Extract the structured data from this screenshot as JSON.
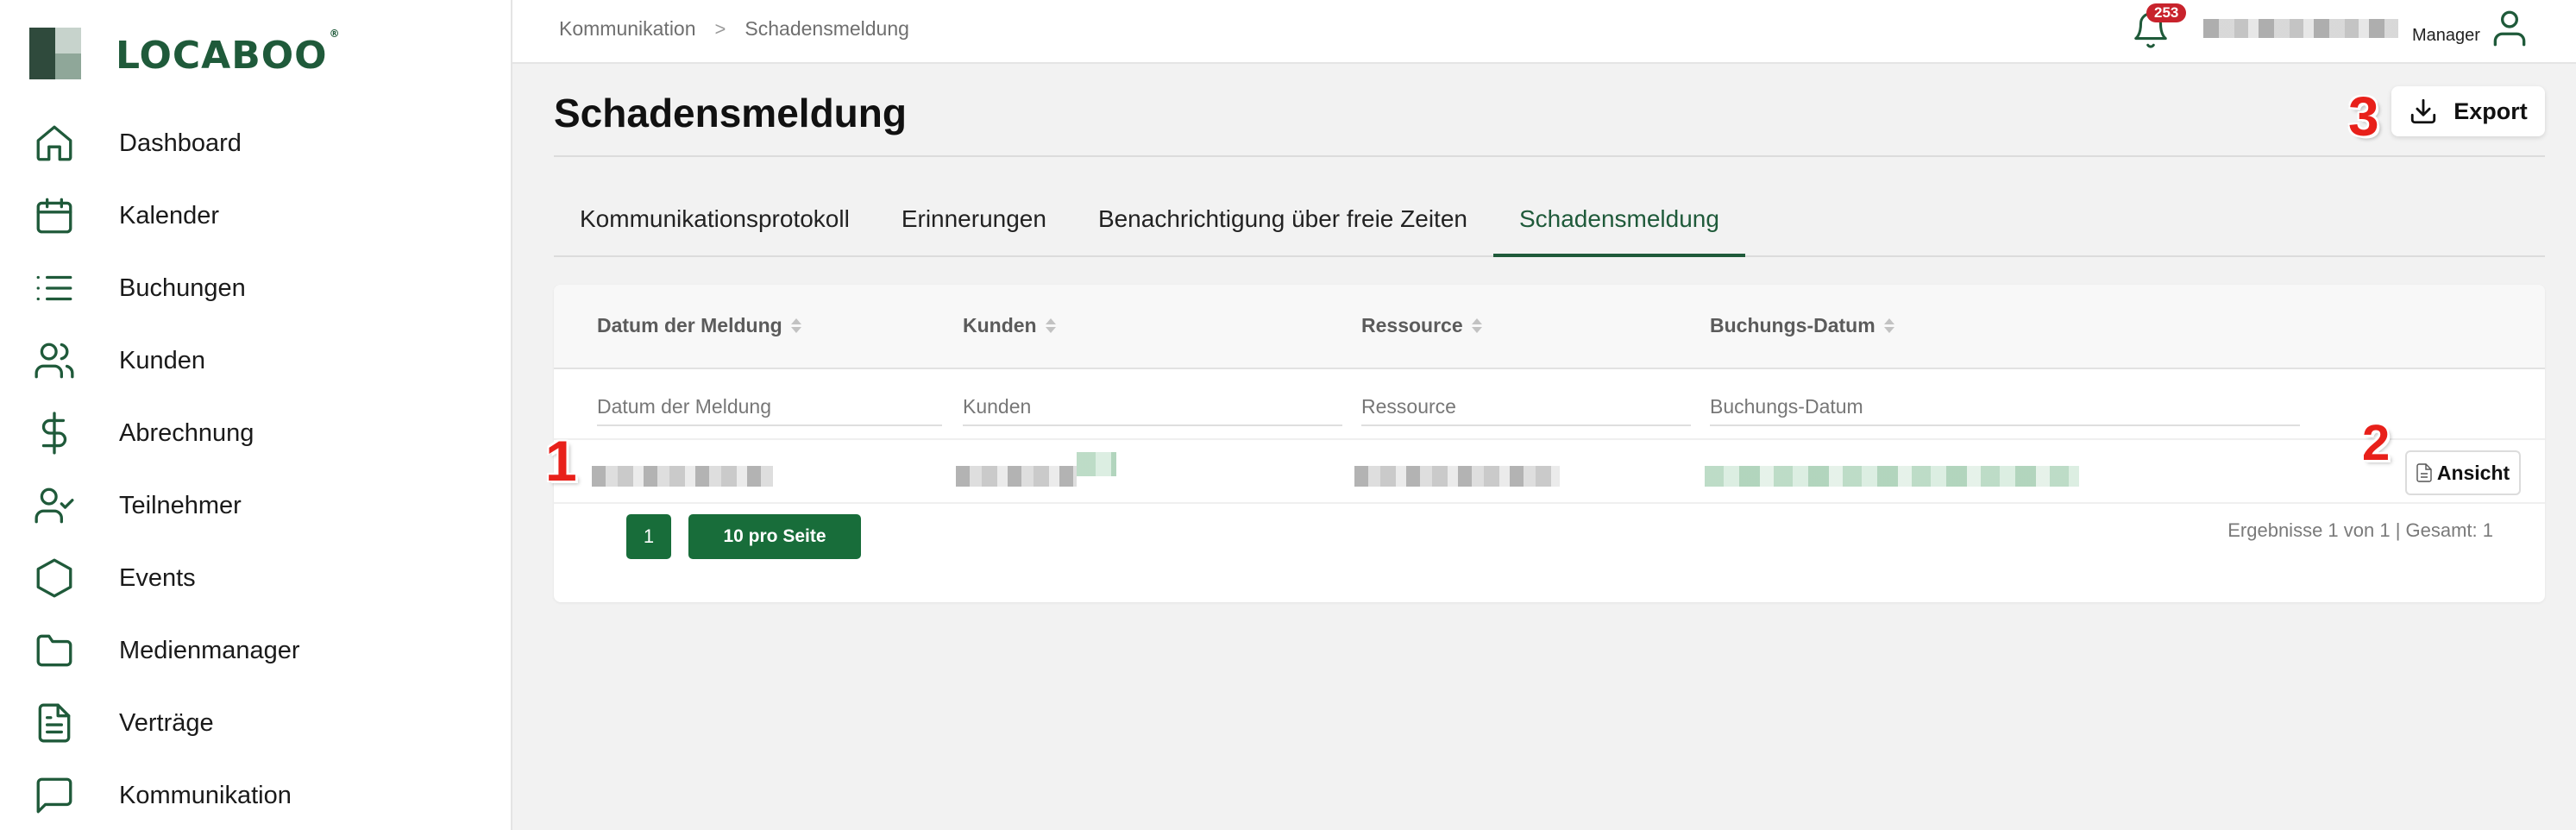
{
  "app": {
    "logo_text": "LOCABOO",
    "logo_mark": "®"
  },
  "colors": {
    "brand_green": "#1f5a3a",
    "button_green": "#186d3a",
    "badge_red": "#c8232c",
    "annotation_red": "#e8201a"
  },
  "sidebar": {
    "items": [
      {
        "label": "Dashboard",
        "icon": "home-icon"
      },
      {
        "label": "Kalender",
        "icon": "calendar-icon"
      },
      {
        "label": "Buchungen",
        "icon": "list-icon"
      },
      {
        "label": "Kunden",
        "icon": "users-icon"
      },
      {
        "label": "Abrechnung",
        "icon": "dollar-icon"
      },
      {
        "label": "Teilnehmer",
        "icon": "user-check-icon"
      },
      {
        "label": "Events",
        "icon": "hexagon-icon"
      },
      {
        "label": "Medienmanager",
        "icon": "folder-icon"
      },
      {
        "label": "Verträge",
        "icon": "document-icon"
      },
      {
        "label": "Kommunikation",
        "icon": "chat-icon"
      }
    ]
  },
  "topbar": {
    "breadcrumb": [
      "Kommunikation",
      "Schadensmeldung"
    ],
    "breadcrumb_separator": ">",
    "notification_count": "253",
    "user_role": "Manager"
  },
  "main": {
    "title": "Schadensmeldung",
    "export_label": "Export",
    "tabs": [
      {
        "label": "Kommunikationsprotokoll",
        "active": false
      },
      {
        "label": "Erinnerungen",
        "active": false
      },
      {
        "label": "Benachrichtigung über freie Zeiten",
        "active": false
      },
      {
        "label": "Schadensmeldung",
        "active": true
      }
    ]
  },
  "table": {
    "columns": [
      "Datum der Meldung",
      "Kunden",
      "Ressource",
      "Buchungs-Datum"
    ],
    "filter_placeholders": [
      "Datum der Meldung",
      "Kunden",
      "Ressource",
      "Buchungs-Datum"
    ],
    "view_button_label": "Ansicht"
  },
  "pagination": {
    "current_page": "1",
    "per_page_label": "10 pro Seite",
    "results_text": "Ergebnisse 1 von 1 | Gesamt: 1"
  },
  "annotations": [
    "1",
    "2",
    "3"
  ]
}
